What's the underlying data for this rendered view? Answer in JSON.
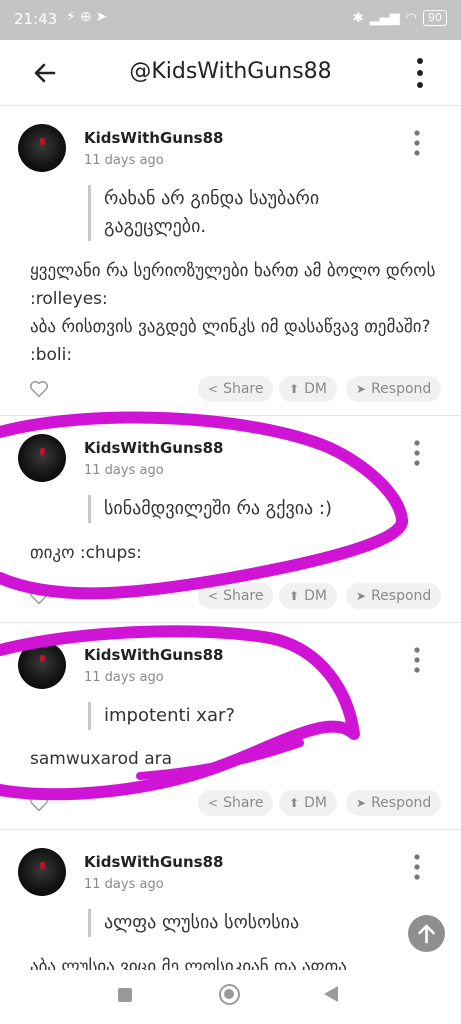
{
  "status": {
    "time": "21:43",
    "battery": "90"
  },
  "header": {
    "title": "@KidsWithGuns88"
  },
  "actions": {
    "share": "Share",
    "dm": "DM",
    "respond": "Respond"
  },
  "posts": [
    {
      "author": "KidsWithGuns88",
      "date": "11 days ago",
      "quote": "რახან არ გინდა საუბარი გაგეცლები.",
      "body": "ყველანი რა სერიოზულები ხართ ამ ბოლო დროს :rolleyes:\nაბა რისთვის ვაგდებ ლინკს იმ დასაწვავ თემაში? :boli:"
    },
    {
      "author": "KidsWithGuns88",
      "date": "11 days ago",
      "quote": "სინამდვილეში რა გქვია :)",
      "body": "თიკო :chups:"
    },
    {
      "author": "KidsWithGuns88",
      "date": "11 days ago",
      "quote": "impotenti xar?",
      "body": "samwuxarod ara"
    },
    {
      "author": "KidsWithGuns88",
      "date": "11 days ago",
      "quote": "ალფა ლუსია სოსოსია",
      "body": "აბა ლუსია ვიცი მე ლოსიკიან და აფთა"
    }
  ],
  "colors": {
    "scribble": "#d014d6",
    "statusbar": "#c4c4c4",
    "chip": "#f1f1f1"
  },
  "icons": [
    "back-arrow-icon",
    "more-vertical-icon",
    "heart-icon",
    "share-icon",
    "dm-icon",
    "respond-icon",
    "arrow-up-icon"
  ]
}
